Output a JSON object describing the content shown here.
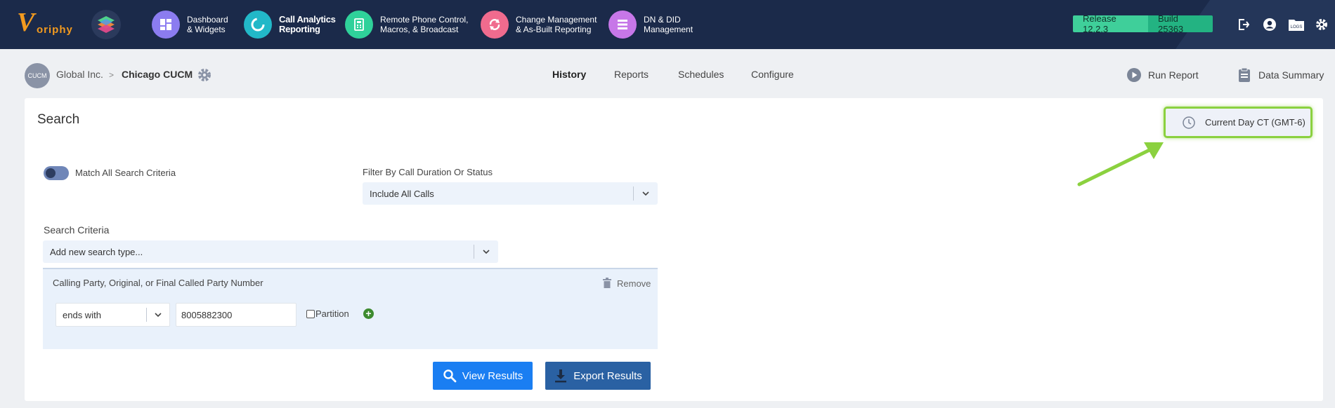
{
  "app": {
    "logo_text": "oriphy",
    "logo_letter": "V"
  },
  "nav": [
    {
      "label": "Dashboard\n& Widgets",
      "icon": "dashboard-icon",
      "color": "#8b7cf0",
      "active": false
    },
    {
      "label": "Call Analytics\nReporting",
      "icon": "call-analytics-icon",
      "color": "#22b8c8",
      "active": true
    },
    {
      "label": "Remote Phone Control,\nMacros, & Broadcast",
      "icon": "remote-phone-icon",
      "color": "#2fd19a",
      "active": false
    },
    {
      "label": "Change Management\n& As-Built Reporting",
      "icon": "change-management-icon",
      "color": "#f06b8e",
      "active": false
    },
    {
      "label": "DN & DID\nManagement",
      "icon": "dn-did-icon",
      "color": "#c777e8",
      "active": false
    }
  ],
  "version": {
    "release": "Release 12.2.3",
    "build": "Build 25363"
  },
  "breadcrumb": {
    "avatar": "CUCM",
    "parent": "Global Inc.",
    "separator": ">",
    "current": "Chicago CUCM"
  },
  "tabs": [
    "History",
    "Reports",
    "Schedules",
    "Configure"
  ],
  "actions": {
    "run_report": "Run Report",
    "data_summary": "Data Summary"
  },
  "search": {
    "title": "Search",
    "timezone": "Current Day CT (GMT-6)",
    "match_all_label": "Match All Search Criteria",
    "filter_label": "Filter By Call Duration Or Status",
    "filter_value": "Include All Calls",
    "criteria_label": "Search Criteria",
    "add_type_placeholder": "Add new search type...",
    "criterion": {
      "title": "Calling Party, Original, or Final Called Party Number",
      "remove": "Remove",
      "operator": "ends with",
      "value": "8005882300",
      "partition_label": "Partition",
      "add": "+"
    },
    "view_results": "View Results",
    "export_results": "Export Results"
  },
  "colors": {
    "topbar": "#1b2a4a",
    "highlight": "#8bd13f",
    "primary_button": "#1a7ef2",
    "secondary_button": "#2a61a3"
  }
}
